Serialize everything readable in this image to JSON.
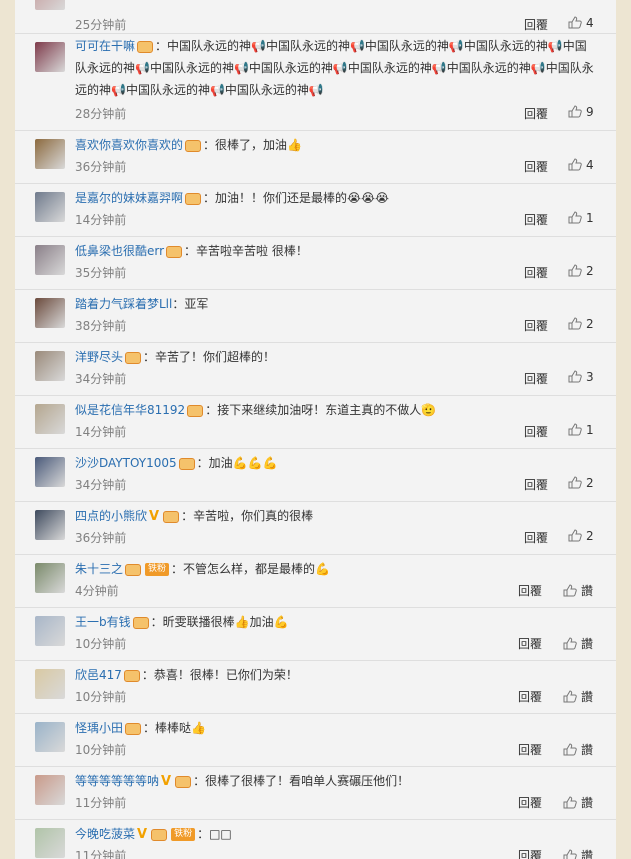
{
  "reply_label": "回覆",
  "praise_label": "讚",
  "comments": [
    {
      "user": "",
      "badge": true,
      "text": "",
      "time": "25分钟前",
      "likes": "4",
      "avatar_color": "#c8a5a5"
    },
    {
      "user": "可可在干嘛",
      "badge": true,
      "text": "：中国队永远的神📢中国队永远的神📢中国队永远的神📢中国队永远的神📢中国队永远的神📢中国队永远的神📢中国队永远的神📢中国队永远的神📢中国队永远的神📢中国队永远的神📢中国队永远的神📢中国队永远的神📢",
      "time": "28分钟前",
      "likes": "9",
      "avatar_color": "#7e3a4a"
    },
    {
      "user": "喜欢你喜欢你喜欢的",
      "badge": true,
      "text": "：很棒了，加油👍",
      "time": "36分钟前",
      "likes": "4",
      "avatar_color": "#8c6a3e"
    },
    {
      "user": "是嘉尔的妹妹嘉羿啊",
      "badge": true,
      "text": "：加油！！你们还是最棒的😭😭😭",
      "time": "14分钟前",
      "likes": "1",
      "avatar_color": "#6f7a8c"
    },
    {
      "user": "低鼻梁也很酷err",
      "badge": true,
      "text": "：辛苦啦辛苦啦 很棒！",
      "time": "35分钟前",
      "likes": "2",
      "avatar_color": "#8a7f88"
    },
    {
      "user": "踏着力气踩着梦Lll",
      "badge": false,
      "text": "：亚军",
      "time": "38分钟前",
      "likes": "2",
      "avatar_color": "#6b4a3c"
    },
    {
      "user": "洋野尽头",
      "badge": true,
      "text": "：辛苦了！你们超棒的！",
      "time": "34分钟前",
      "likes": "3",
      "avatar_color": "#9a8a7a"
    },
    {
      "user": "似是花信年华81192",
      "badge": true,
      "text": "：接下来继续加油呀！东道主真的不做人🫡",
      "time": "14分钟前",
      "likes": "1",
      "avatar_color": "#b4a68f"
    },
    {
      "user": "沙沙DAYTOY1005",
      "badge": true,
      "text": "：加油💪💪💪",
      "time": "34分钟前",
      "likes": "2",
      "avatar_color": "#4a5a7a"
    },
    {
      "user": "四点的小熊欣",
      "vip": true,
      "badge": true,
      "text": "：辛苦啦，你们真的很棒",
      "time": "36分钟前",
      "likes": "2",
      "avatar_color": "#3e4a5e"
    },
    {
      "user": "朱十三之",
      "badge": true,
      "fan": "铁粉",
      "text": "：不管怎么样，都是最棒的💪",
      "time": "4分钟前",
      "likes": "讚",
      "avatar_color": "#7a8a6a"
    },
    {
      "user": "王一b有钱",
      "badge": true,
      "text": "：昕雯联播很棒👍加油💪",
      "time": "10分钟前",
      "likes": "讚",
      "avatar_color": "#a8b6c8"
    },
    {
      "user": "欣邑417",
      "badge": true,
      "text": "：恭喜！很棒！已你们为荣！",
      "time": "10分钟前",
      "likes": "讚",
      "avatar_color": "#d9c9a3"
    },
    {
      "user": "怪瑀小田",
      "badge": true,
      "text": "：棒棒哒👍",
      "time": "10分钟前",
      "likes": "讚",
      "avatar_color": "#9ab3c9"
    },
    {
      "user": "等等等等等等呐",
      "vip": true,
      "badge": true,
      "text": "：很棒了很棒了！看咱单人赛碾压他们！",
      "time": "11分钟前",
      "likes": "讚",
      "avatar_color": "#c99a8a"
    },
    {
      "user": "今晚吃菠菜",
      "vip": true,
      "badge": true,
      "fan": "铁粉",
      "text": "：□□",
      "time": "11分钟前",
      "likes": "讚",
      "avatar_color": "#b0c4a8"
    }
  ]
}
